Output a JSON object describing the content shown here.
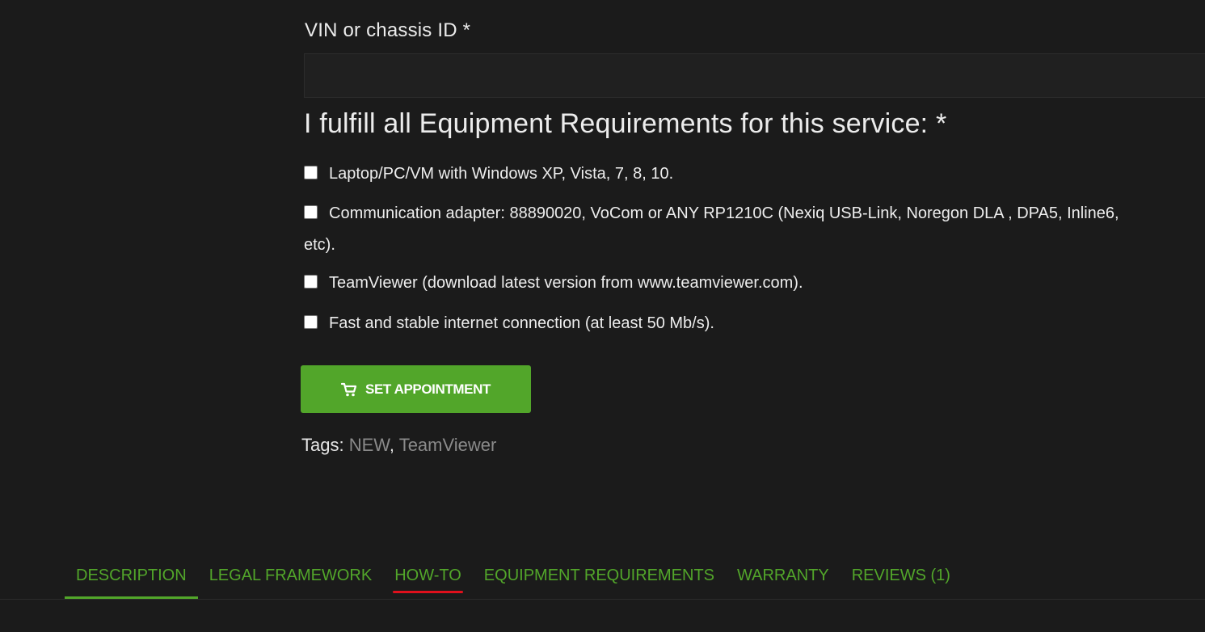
{
  "form": {
    "vin_label": "VIN or chassis ID *",
    "vin_value": "",
    "requirements_heading": "I fulfill all Equipment Requirements for this service: *",
    "requirements": [
      {
        "label": "Laptop/PC/VM with Windows XP, Vista, 7, 8, 10.",
        "checked": false
      },
      {
        "label": "Communication adapter: 88890020, VoCom or ANY RP1210C (Nexiq USB-Link, Noregon DLA , DPA5, Inline6,",
        "checked": false,
        "label_cont": "etc)."
      },
      {
        "label": "TeamViewer (download latest version from www.teamviewer.com).",
        "checked": false
      },
      {
        "label": "Fast and stable internet connection (at least 50 Mb/s).",
        "checked": false
      }
    ],
    "submit_label": "SET APPOINTMENT",
    "submit_icon": "cart-icon"
  },
  "tags": {
    "label": "Tags:",
    "items": [
      "NEW",
      "TeamViewer"
    ],
    "separator": ","
  },
  "tabs": [
    {
      "label": "DESCRIPTION",
      "active": true
    },
    {
      "label": "LEGAL FRAMEWORK",
      "active": false
    },
    {
      "label": "HOW-TO",
      "active": false,
      "highlighted": true
    },
    {
      "label": "EQUIPMENT REQUIREMENTS",
      "active": false
    },
    {
      "label": "WARRANTY",
      "active": false
    },
    {
      "label": "REVIEWS (1)",
      "active": false
    }
  ],
  "colors": {
    "background": "#1b1b1b",
    "accent_green": "#52a62a",
    "tag_link": "#8a8a8a",
    "highlight_red": "#e0101c"
  }
}
